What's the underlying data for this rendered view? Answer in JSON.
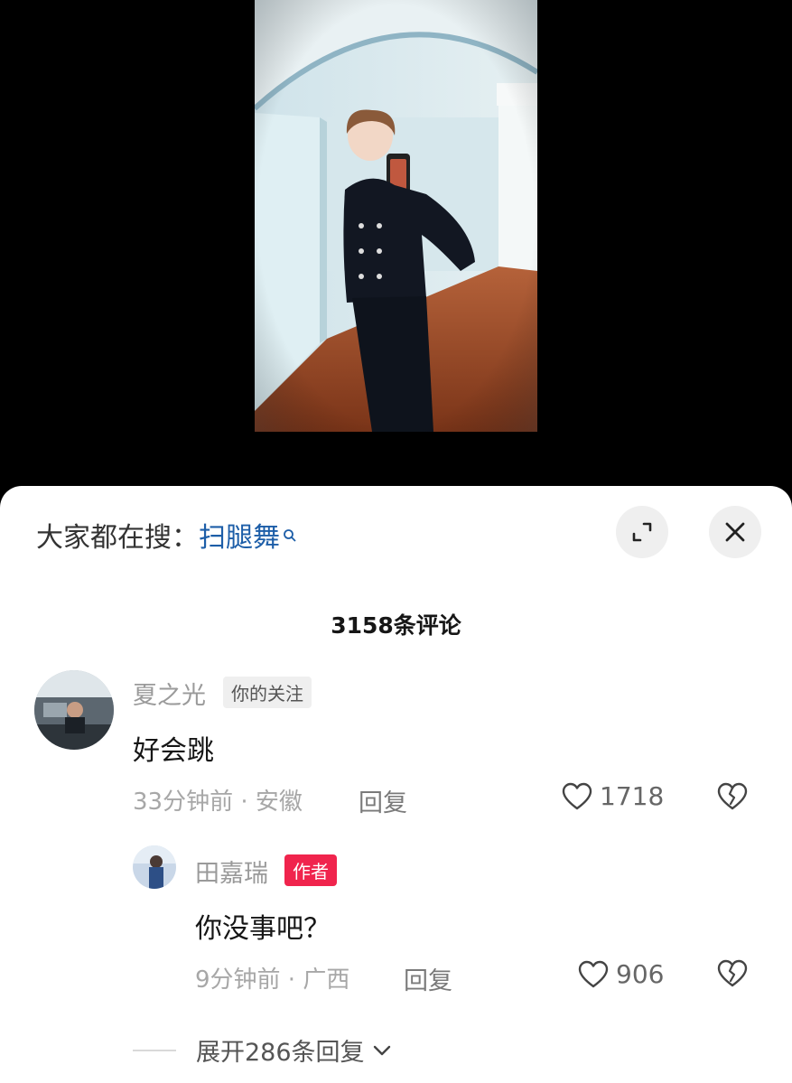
{
  "search_hint": {
    "prefix": "大家都在搜：",
    "keyword": "扫腿舞"
  },
  "comments_count": "3158条评论",
  "comments": [
    {
      "user": "夏之光",
      "tag": "你的关注",
      "text": "好会跳",
      "time": "33分钟前 · 安徽",
      "reply_label": "回复",
      "likes": "1718"
    }
  ],
  "reply": {
    "user": "田嘉瑞",
    "tag": "作者",
    "text": "你没事吧？",
    "time": "9分钟前 · 广西",
    "reply_label": "回复",
    "likes": "906"
  },
  "expand_replies": "展开286条回复",
  "colors": {
    "keyword": "#1d5ea8",
    "author_tag": "#f0244d",
    "sheet_bg": "#ffffff",
    "video_bg": "#000000"
  },
  "icons": {
    "expand": "expand-icon",
    "close": "close-icon",
    "like": "heart-icon",
    "dislike": "broken-heart-icon",
    "search": "search-icon",
    "chevron": "chevron-down-icon"
  }
}
